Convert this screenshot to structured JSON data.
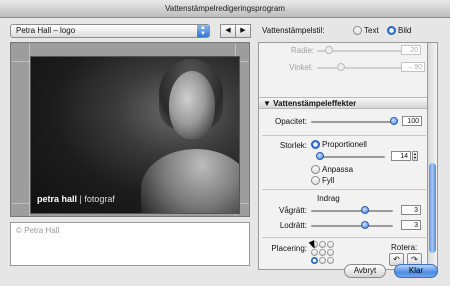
{
  "window": {
    "title": "Vattenstämpelredigeringsprogram"
  },
  "preset": {
    "selected": "Petra Hall – logo",
    "prev_label": "◀",
    "next_label": "▶"
  },
  "preview": {
    "watermark_name": "petra hall",
    "watermark_sep": " | ",
    "watermark_word": "fotograf"
  },
  "copyright_text": "© Petra Hall",
  "style": {
    "label": "Vattenstämpelstil:",
    "text_option": "Text",
    "image_option": "Bild",
    "selected": "Bild"
  },
  "panel": {
    "radius": {
      "label": "Radie:",
      "value": "20",
      "level": 0.4
    },
    "angle": {
      "label": "Vinkel:",
      "value": "– 90",
      "level": 0.3
    },
    "effects_header": "Vattenstämpeleffekter",
    "opacity": {
      "label": "Opacitet:",
      "value": "100",
      "level": 1.0
    },
    "size": {
      "label": "Storlek:",
      "options": [
        "Proportionell",
        "Anpassa",
        "Fyll"
      ],
      "selected": "Proportionell",
      "value": "14",
      "level": 0.06
    },
    "indent": {
      "label": "Indrag",
      "horizontal": {
        "label": "Vågrätt:",
        "value": "3",
        "level": 0.65
      },
      "vertical": {
        "label": "Lodrätt:",
        "value": "3",
        "level": 0.65
      }
    },
    "placement": {
      "label": "Placering:",
      "selected": "bottom-left"
    },
    "rotate": {
      "label": "Rotera:",
      "left_label": "↶",
      "right_label": "↷"
    }
  },
  "buttons": {
    "cancel": "Avbryt",
    "ok": "Klar"
  },
  "colors": {
    "accent": "#3b7ae0",
    "window": "#e6e6e6"
  }
}
